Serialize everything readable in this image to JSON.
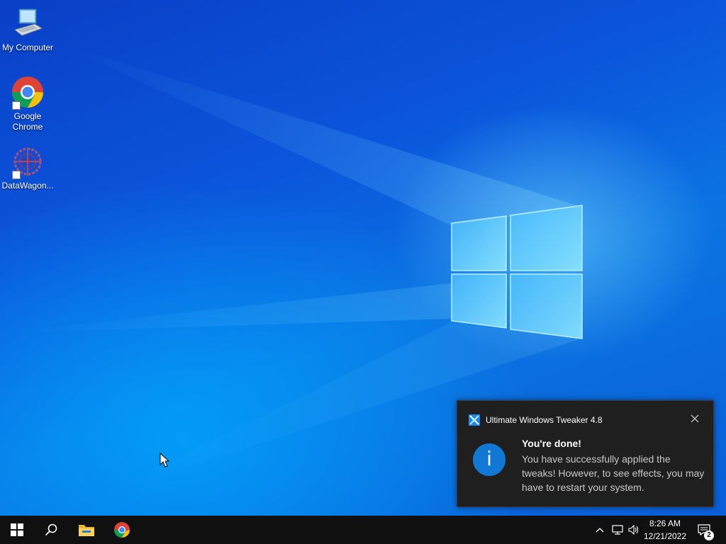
{
  "desktop": {
    "icons": [
      {
        "label": "My Computer",
        "icon": "computer-icon"
      },
      {
        "label": "Google\nChrome",
        "icon": "chrome-icon"
      },
      {
        "label": "DataWagon...",
        "icon": "datawagon-icon"
      }
    ]
  },
  "toast": {
    "app_name": "Ultimate Windows Tweaker 4.8",
    "title": "You're done!",
    "body": "You have successfully applied the tweaks! However, to see effects, you may have to restart your system.",
    "info_glyph": "i",
    "icons": {
      "app": "tweaker-app-icon",
      "info": "info-icon",
      "close": "close-icon"
    }
  },
  "taskbar": {
    "pinned": [
      "start-icon",
      "search-icon",
      "file-explorer-icon",
      "chrome-icon"
    ],
    "tray": {
      "icons": [
        "chevron-up-icon",
        "network-icon",
        "volume-icon"
      ],
      "time": "8:26 AM",
      "date": "12/21/2022",
      "notification_count": "2"
    }
  },
  "colors": {
    "accent": "#1278d6",
    "taskbar": "#101010",
    "toast_bg": "#1f1f1f"
  }
}
